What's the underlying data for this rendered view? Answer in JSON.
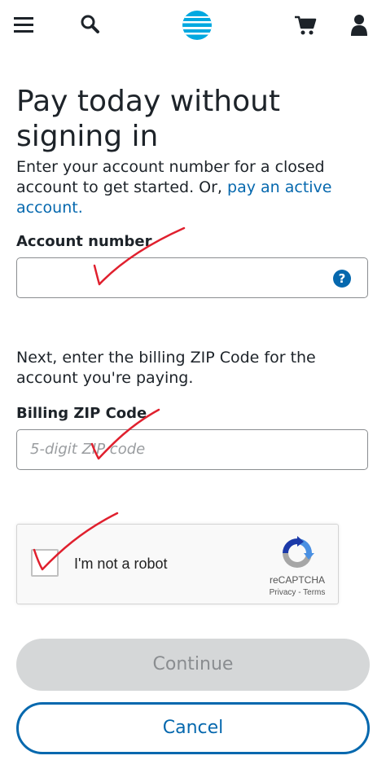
{
  "header": {
    "menu_icon": "hamburger-menu-icon",
    "search_icon": "search-icon",
    "logo_icon": "att-globe-logo",
    "cart_icon": "shopping-cart-icon",
    "account_icon": "user-account-icon"
  },
  "page": {
    "title": "Pay today without signing in",
    "intro": "Enter your account number for a closed account to get started. Or,",
    "intro_link": "pay an active account."
  },
  "account_number": {
    "label": "Account number",
    "value": "",
    "help": "?"
  },
  "zip": {
    "instructions": "Next, enter the billing ZIP Code for the account you're paying.",
    "label": "Billing ZIP Code",
    "value": "",
    "placeholder": "5-digit ZIP code"
  },
  "captcha": {
    "label": "I'm not a robot",
    "brand": "reCAPTCHA",
    "links": "Privacy - Terms"
  },
  "buttons": {
    "continue": "Continue",
    "cancel": "Cancel"
  },
  "colors": {
    "brand_blue": "#0568ae",
    "att_logo": "#00a8e0",
    "annotation_red": "#e0202e"
  }
}
